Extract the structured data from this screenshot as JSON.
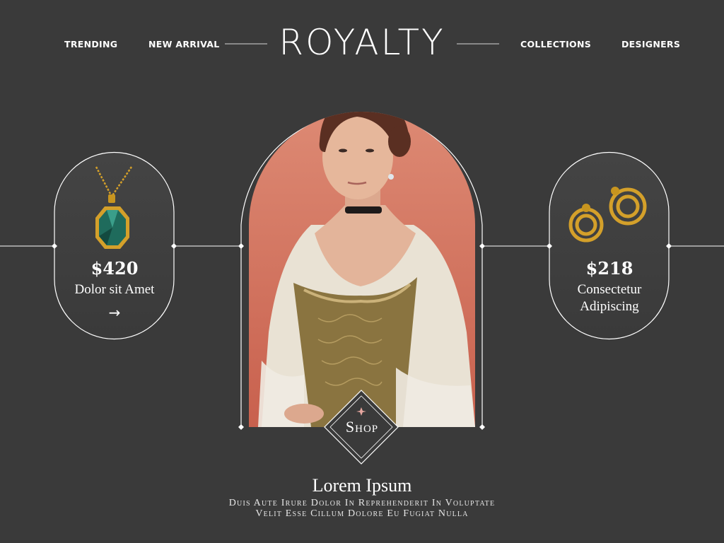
{
  "nav": {
    "left": [
      "TRENDING",
      "NEW ARRIVAL"
    ],
    "right": [
      "COLLECTIONS",
      "DESIGNERS"
    ]
  },
  "brand": {
    "logo": "ROYALTY"
  },
  "products": [
    {
      "price": "$420",
      "name": "Dolor sit Amet",
      "icon": "pendant-necklace-icon",
      "arrow": "→"
    },
    {
      "price": "$218",
      "name_lines": [
        "Consectetur",
        "Adipiscing"
      ],
      "icon": "gold-earrings-icon"
    }
  ],
  "hero": {
    "image": "portrait-woman-tiara-corset",
    "backdrop_color": "#d4786a"
  },
  "shop_button": {
    "label": "Shop"
  },
  "footer": {
    "title": "Lorem Ipsum",
    "lines": [
      "Duis Aute Irure Dolor In Reprehenderit In Voluptate",
      "Velit Esse Cillum Dolore Eu Fugiat Nulla"
    ]
  },
  "colors": {
    "background": "#3a3a3a",
    "line": "#ffffff",
    "gold": "#d4a02a",
    "emerald": "#1f6b5c"
  }
}
